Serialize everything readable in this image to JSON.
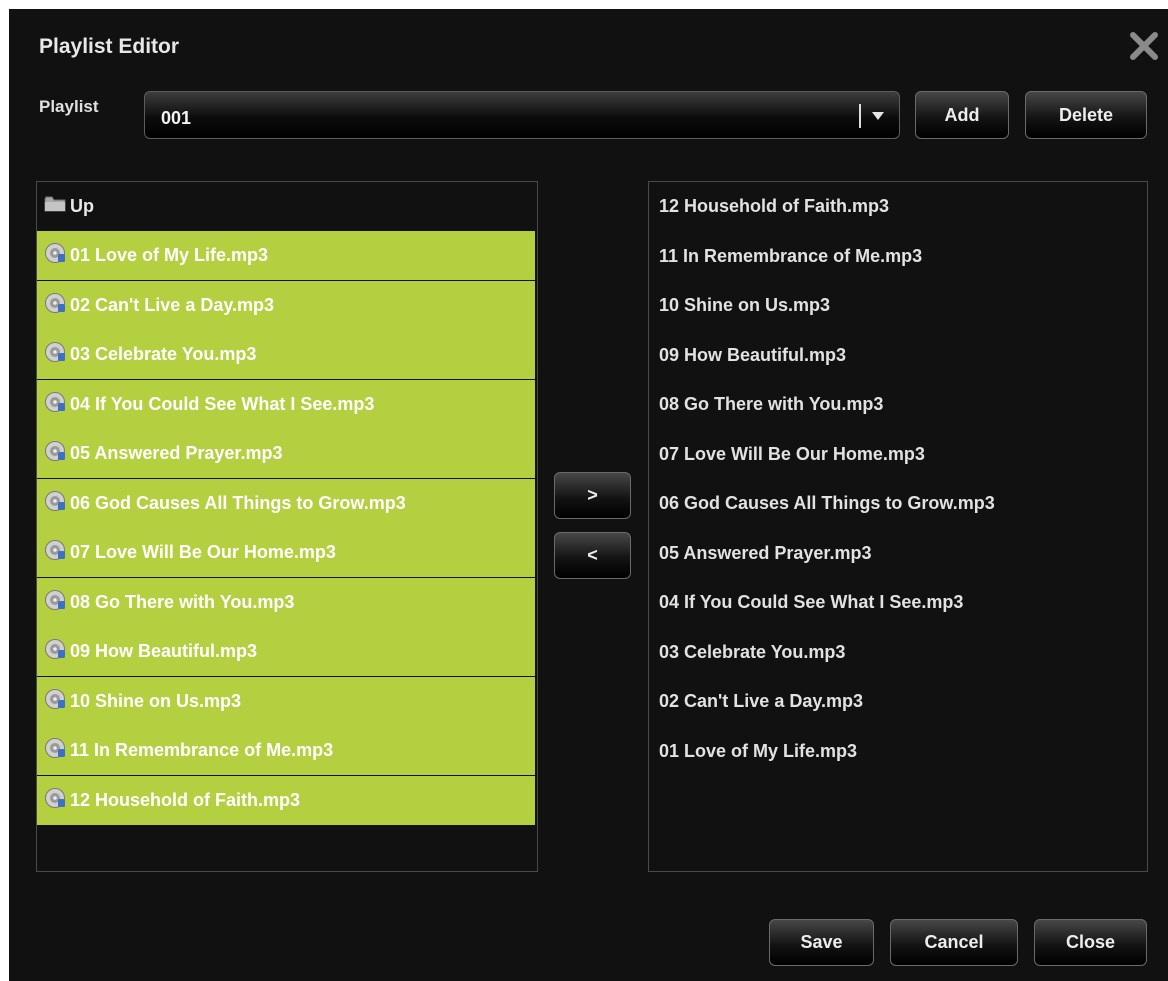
{
  "dialog": {
    "title": "Playlist Editor",
    "close_icon": "close-x-icon"
  },
  "playlist": {
    "label": "Playlist",
    "selected": "001",
    "add_label": "Add",
    "delete_label": "Delete"
  },
  "source_list": {
    "up_label": "Up",
    "up_icon": "folder-icon",
    "item_icon": "audio-file-icon",
    "items": [
      {
        "label": "01 Love of My Life.mp3"
      },
      {
        "label": "02 Can't Live a Day.mp3"
      },
      {
        "label": "03 Celebrate You.mp3"
      },
      {
        "label": "04 If You Could See What I See.mp3"
      },
      {
        "label": "05 Answered Prayer.mp3"
      },
      {
        "label": "06 God Causes All Things to Grow.mp3"
      },
      {
        "label": "07 Love Will Be Our Home.mp3"
      },
      {
        "label": "08 Go There with You.mp3"
      },
      {
        "label": "09 How Beautiful.mp3"
      },
      {
        "label": "10 Shine on Us.mp3"
      },
      {
        "label": "11 In Remembrance of Me.mp3"
      },
      {
        "label": "12 Household of Faith.mp3"
      }
    ],
    "selection_color": "#b4cf3f"
  },
  "transfer": {
    "add_label": ">",
    "remove_label": "<"
  },
  "playlist_items": [
    {
      "label": "12 Household of Faith.mp3"
    },
    {
      "label": "11 In Remembrance of Me.mp3"
    },
    {
      "label": "10 Shine on Us.mp3"
    },
    {
      "label": "09 How Beautiful.mp3"
    },
    {
      "label": "08 Go There with You.mp3"
    },
    {
      "label": "07 Love Will Be Our Home.mp3"
    },
    {
      "label": "06 God Causes All Things to Grow.mp3"
    },
    {
      "label": "05 Answered Prayer.mp3"
    },
    {
      "label": "04 If You Could See What I See.mp3"
    },
    {
      "label": "03 Celebrate You.mp3"
    },
    {
      "label": "02 Can't Live a Day.mp3"
    },
    {
      "label": "01 Love of My Life.mp3"
    }
  ],
  "footer": {
    "save_label": "Save",
    "cancel_label": "Cancel",
    "close_label": "Close"
  }
}
